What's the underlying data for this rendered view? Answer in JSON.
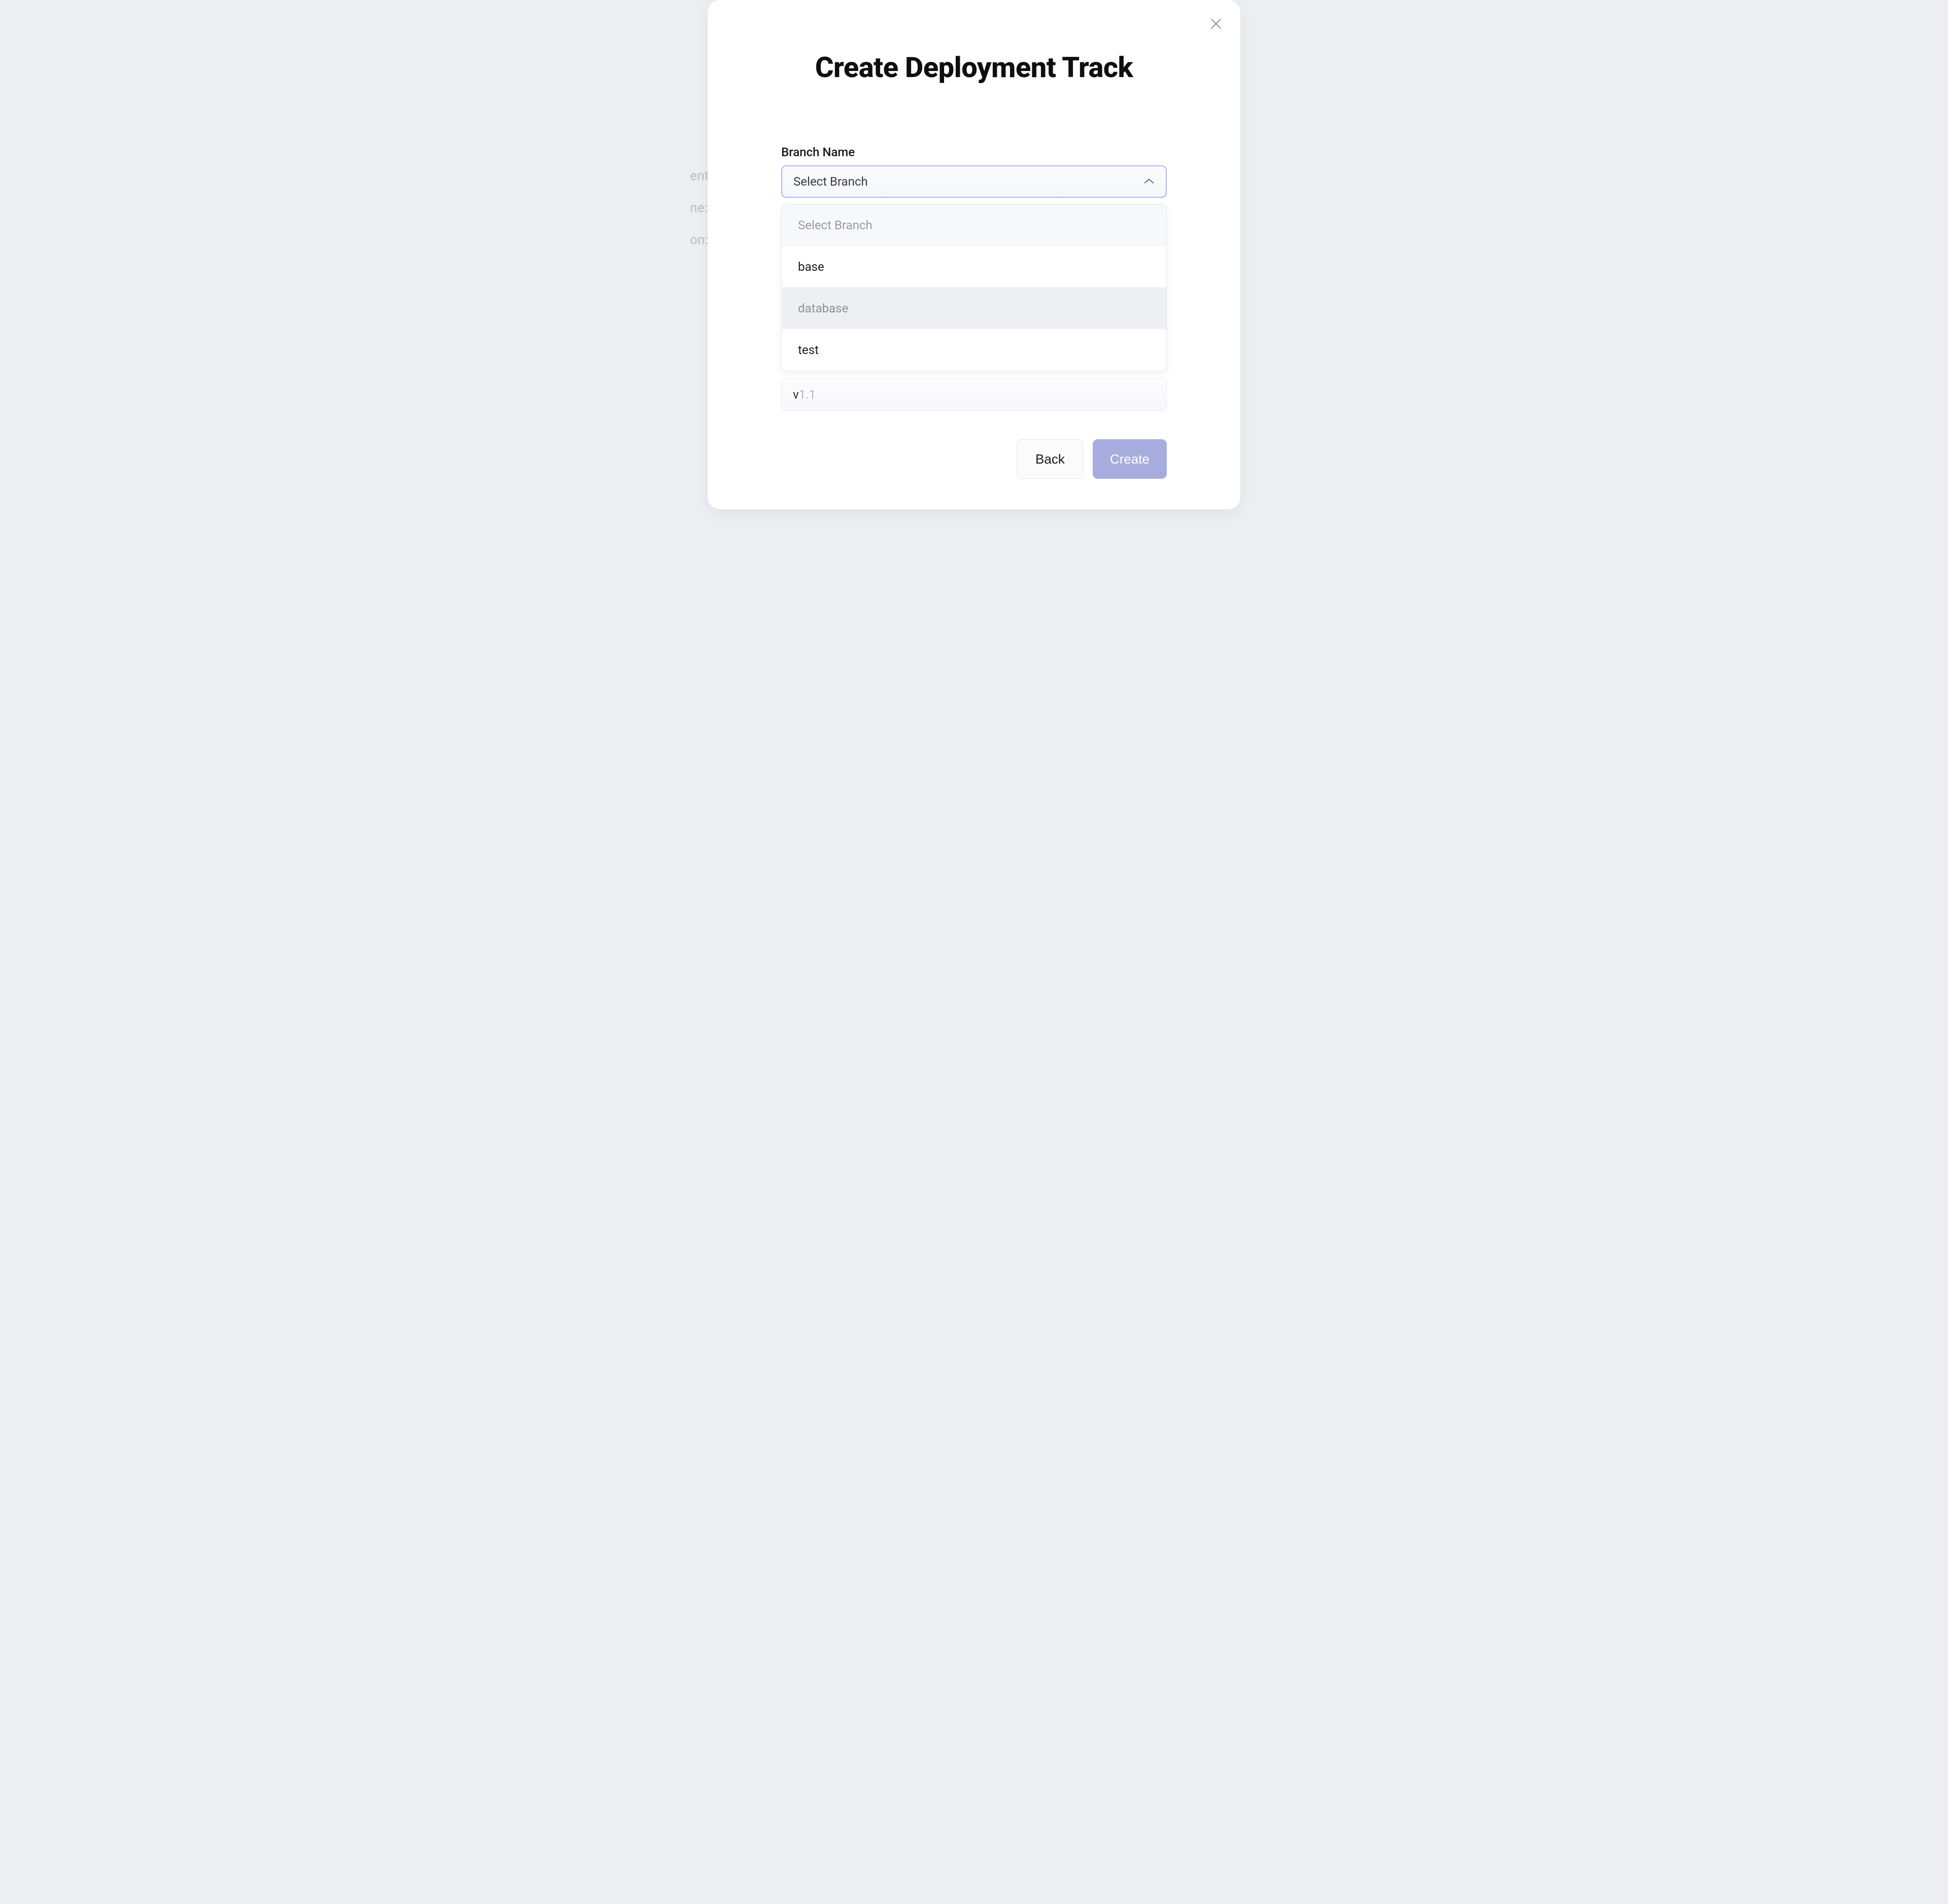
{
  "modal": {
    "title": "Create Deployment Track",
    "close_aria": "Close"
  },
  "form": {
    "branch": {
      "label": "Branch Name",
      "placeholder": "Select Branch",
      "options": [
        {
          "label": "Select Branch",
          "is_placeholder": true,
          "hovered": false
        },
        {
          "label": "base",
          "is_placeholder": false,
          "hovered": false
        },
        {
          "label": "database",
          "is_placeholder": false,
          "hovered": true
        },
        {
          "label": "test",
          "is_placeholder": false,
          "hovered": false
        }
      ]
    },
    "version": {
      "prefix": "v",
      "suffix": "1.1"
    }
  },
  "footer": {
    "back": "Back",
    "create": "Create"
  },
  "background_fragments": {
    "line1": "ent",
    "line2": "ne:",
    "line3": "on:"
  }
}
